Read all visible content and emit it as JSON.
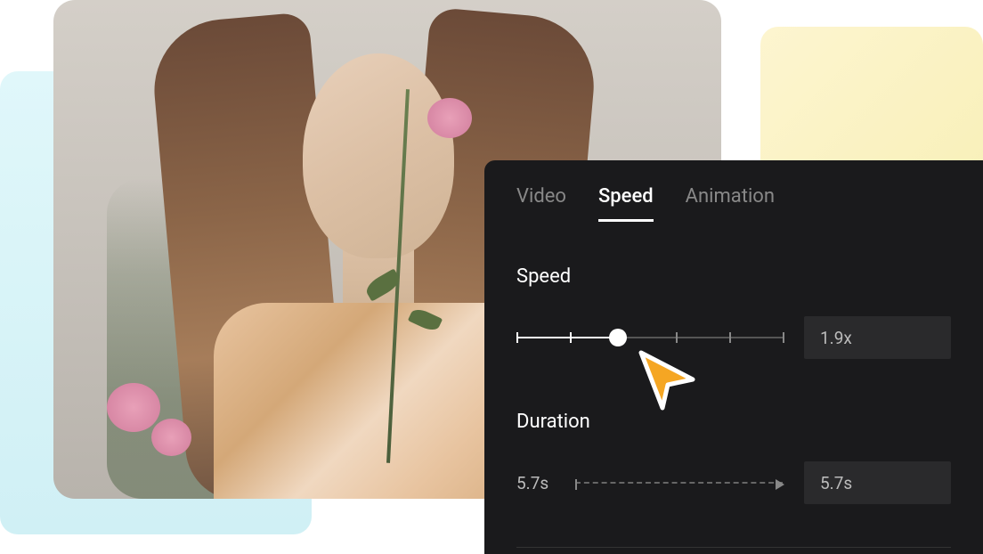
{
  "tabs": {
    "video": "Video",
    "speed": "Speed",
    "animation": "Animation"
  },
  "speed": {
    "label": "Speed",
    "value": "1.9x",
    "slider_percent": 38
  },
  "duration": {
    "label": "Duration",
    "current": "5.7s",
    "value": "5.7s"
  }
}
